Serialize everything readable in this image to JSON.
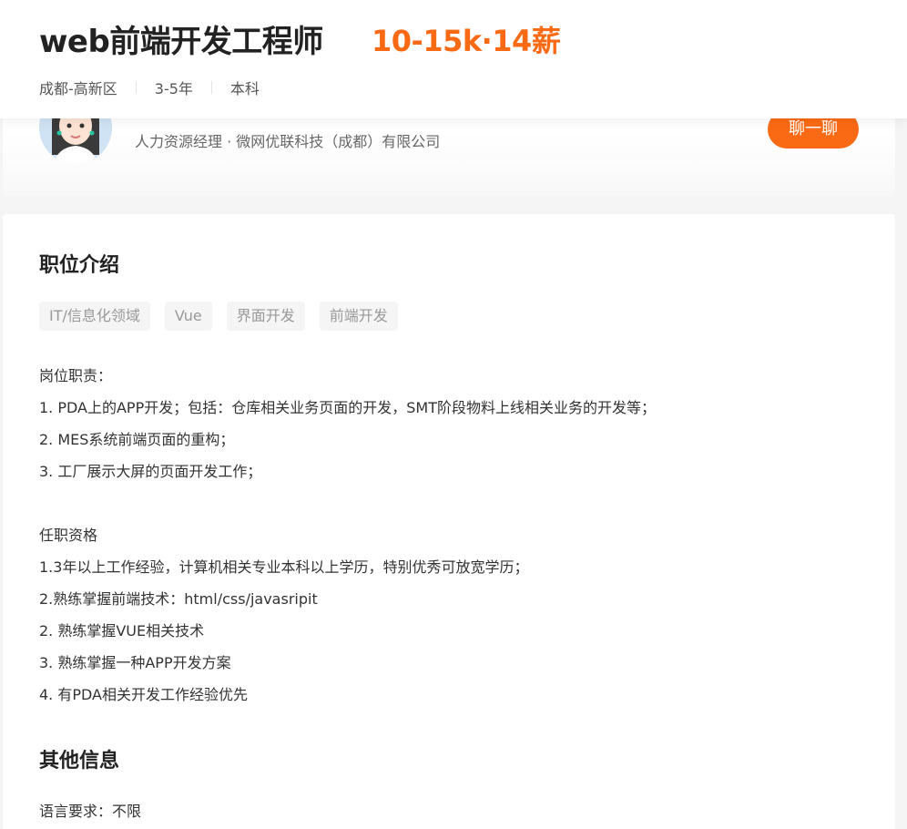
{
  "job": {
    "title": "web前端开发工程师",
    "salary": "10-15k·14薪",
    "location": "成都-高新区",
    "experience": "3-5年",
    "education": "本科"
  },
  "recruiter": {
    "info": "人力资源经理 · 微网优联科技（成都）有限公司",
    "chat_label": "聊一聊"
  },
  "description": {
    "title": "职位介绍",
    "tags": [
      "IT/信息化领域",
      "Vue",
      "界面开发",
      "前端开发"
    ],
    "lines": [
      "岗位职责：",
      "1. PDA上的APP开发；包括：仓库相关业务页面的开发，SMT阶段物料上线相关业务的开发等；",
      "2. MES系统前端页面的重构；",
      "3. 工厂展示大屏的页面开发工作；",
      "",
      "任职资格",
      "1.3年以上工作经验，计算机相关专业本科以上学历，特别优秀可放宽学历；",
      "2.熟练掌握前端技术：html/css/javasripit",
      "2. 熟练掌握VUE相关技术",
      "3. 熟练掌握一种APP开发方案",
      "4. 有PDA相关开发工作经验优先"
    ]
  },
  "other": {
    "title": "其他信息",
    "language": "语言要求：不限"
  },
  "colors": {
    "accent": "#fa6a14",
    "background": "#f5f5f6"
  }
}
